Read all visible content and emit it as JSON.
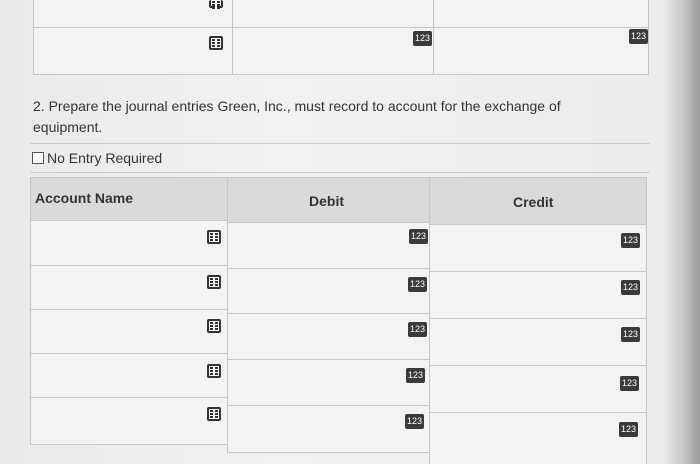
{
  "top_table": {
    "row": {
      "debit_icon": "123",
      "credit_icon": "123"
    }
  },
  "question": {
    "text": "2. Prepare the journal entries Green, Inc., must record to account for the exchange of equipment."
  },
  "no_entry": {
    "label": "No Entry Required"
  },
  "journal_table": {
    "headers": {
      "account": "Account Name",
      "debit": "Debit",
      "credit": "Credit"
    },
    "rows": [
      {
        "debit_icon": "123",
        "credit_icon": "123"
      },
      {
        "debit_icon": "123",
        "credit_icon": "123"
      },
      {
        "debit_icon": "123",
        "credit_icon": "123"
      },
      {
        "debit_icon": "123",
        "credit_icon": "123"
      },
      {
        "debit_icon": "123",
        "credit_icon": "123"
      }
    ]
  },
  "icons": {
    "account_dropdown": "list-icon",
    "numeric_field": "numeric-123-icon"
  },
  "colors": {
    "header_bg": "#dcdad9",
    "cell_bg": "#f4f3f2",
    "border": "#c9c7c6"
  }
}
